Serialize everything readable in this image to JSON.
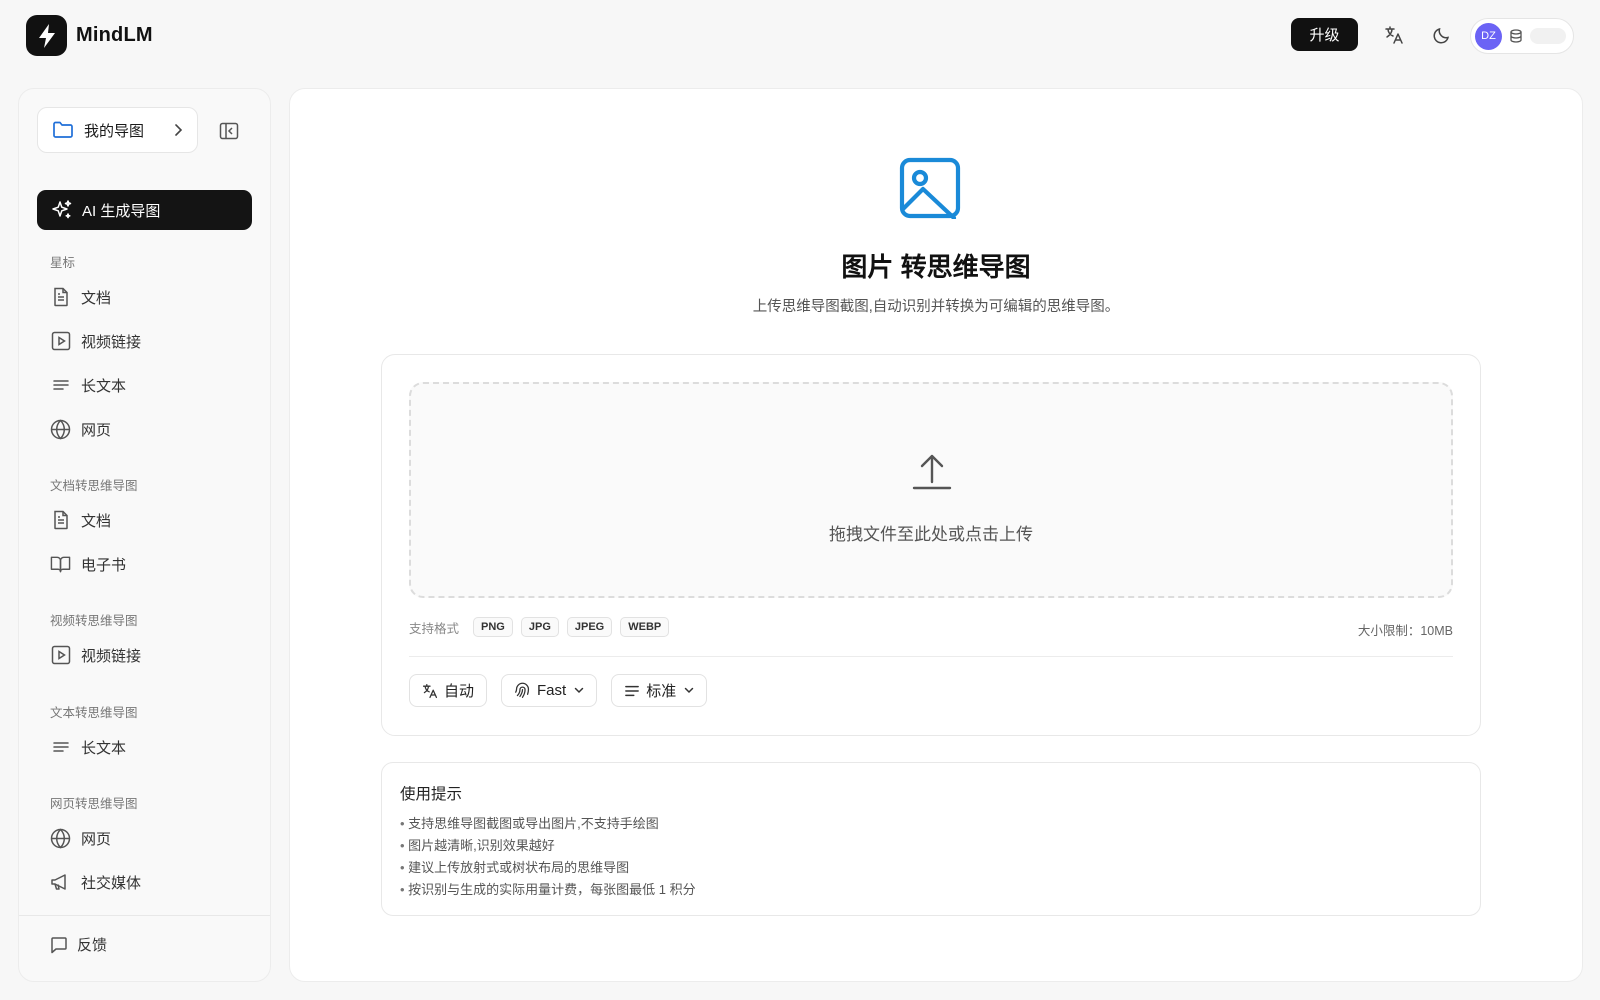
{
  "app": {
    "name": "MindLM"
  },
  "header": {
    "upgrade_label": "升级",
    "translate_icon": "translate-icon",
    "theme_icon": "moon-icon",
    "user": {
      "initials": "DZ",
      "avatar_color": "#6b63f5",
      "credits_icon": "coins-icon"
    }
  },
  "sidebar": {
    "my_maps_label": "我的导图",
    "ai_generate_label": "AI 生成导图",
    "groups": {
      "starred": {
        "title": "星标",
        "items": [
          "文档",
          "视频链接",
          "长文本",
          "网页"
        ]
      },
      "doc": {
        "title": "文档转思维导图",
        "items": [
          "文档",
          "电子书"
        ]
      },
      "video": {
        "title": "视频转思维导图",
        "items": [
          "视频链接"
        ]
      },
      "text": {
        "title": "文本转思维导图",
        "items": [
          "长文本"
        ]
      },
      "web": {
        "title": "网页转思维导图",
        "items": [
          "网页",
          "社交媒体"
        ]
      }
    },
    "feedback_label": "反馈"
  },
  "main": {
    "title": "图片 转思维导图",
    "subtitle": "上传思维导图截图,自动识别并转换为可编辑的思维导图。",
    "accent_color": "#1a8ad8",
    "upload": {
      "drop_text": "拖拽文件至此处或点击上传",
      "formats_label": "支持格式",
      "formats": [
        "PNG",
        "JPG",
        "JPEG",
        "WEBP"
      ],
      "size_limit": "大小限制：10MB"
    },
    "options": {
      "language": "自动",
      "model": "Fast",
      "detail": "标准"
    },
    "tips": {
      "title": "使用提示",
      "items": [
        "支持思维导图截图或导出图片,不支持手绘图",
        "图片越清晰,识别效果越好",
        "建议上传放射式或树状布局的思维导图",
        "按识别与生成的实际用量计费，每张图最低 1 积分"
      ]
    }
  }
}
